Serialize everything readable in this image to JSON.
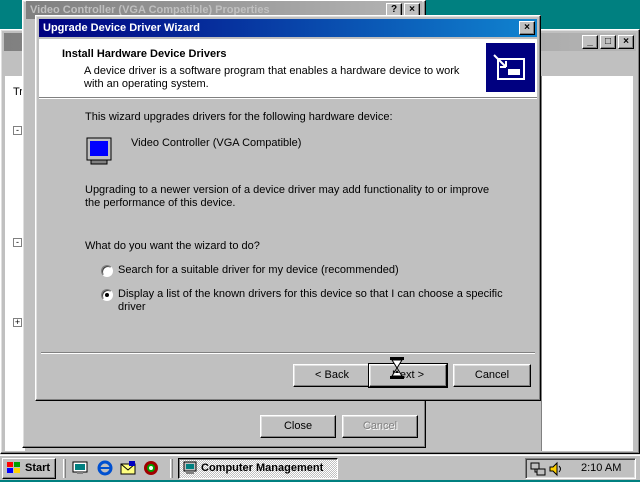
{
  "properties_window": {
    "title": "Video Controller (VGA Compatible) Properties",
    "help_btn": "?",
    "close_btn": "×",
    "close_label": "Close",
    "cancel_label": "Cancel"
  },
  "mgmt_window": {
    "minimize": "_",
    "maximize": "□",
    "close": "×",
    "tab_fragment": "Tr"
  },
  "wizard": {
    "title": "Upgrade Device Driver Wizard",
    "close_btn": "×",
    "header_title": "Install Hardware Device Drivers",
    "header_desc": "A device driver is a software program that enables a hardware device to work with an operating system.",
    "intro": "This wizard upgrades drivers for the following hardware device:",
    "device_name": "Video Controller (VGA Compatible)",
    "upgrade_note": "Upgrading to a newer version of a device driver may add functionality to or improve the performance of this device.",
    "question": "What do you want the wizard to do?",
    "options": [
      {
        "label": "Search for a suitable driver for my device (recommended)",
        "selected": false
      },
      {
        "label": "Display a list of the known drivers for this device so that I can choose a specific driver",
        "selected": true
      }
    ],
    "back_label": "< Back",
    "next_label": "Next >",
    "cancel_label": "Cancel"
  },
  "taskbar": {
    "start_label": "Start",
    "quick_launch": [
      "desktop-icon",
      "ie-icon",
      "outlook-icon",
      "channels-icon"
    ],
    "task_label": "Computer Management",
    "tray_icons": [
      "network-icon",
      "volume-icon"
    ],
    "clock": "2:10 AM"
  },
  "colors": {
    "desktop": "#008080",
    "title_active": "#000080",
    "title_inactive": "#808080",
    "face": "#c0c0c0"
  }
}
